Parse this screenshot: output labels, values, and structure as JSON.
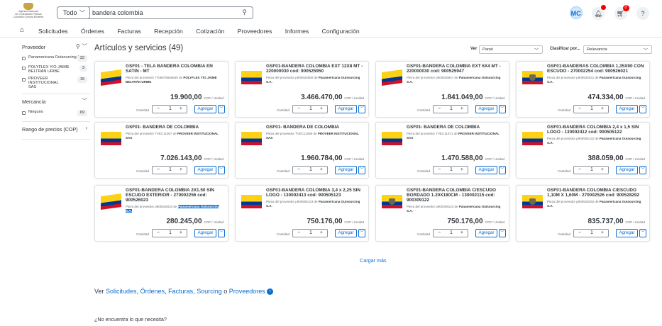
{
  "logo": {
    "lines": [
      "Agencia Nacional",
      "de Contratación Pública",
      "Colombia Compra Eficiente"
    ]
  },
  "search": {
    "scope": "Todo",
    "query": "bandera colombia"
  },
  "user": {
    "initials": "MC",
    "cart_count": "0"
  },
  "help_label": "?",
  "nav": {
    "items": [
      "Solicitudes",
      "Órdenes",
      "Facturas",
      "Recepción",
      "Cotización",
      "Proveedores",
      "Informes",
      "Configuración"
    ]
  },
  "sidebar": {
    "proveedor_title": "Proveedor",
    "suppliers": [
      {
        "name": "Panamericana Outsourcing S.A.",
        "count": "32"
      },
      {
        "name": "POLYFLEX Y/O JAIME BELTRÁN URIBE",
        "count": "3"
      },
      {
        "name": "PROVEER INSTITUCIONAL SAS",
        "count": "15"
      }
    ],
    "mercancia_title": "Mercancía",
    "mercancia": [
      {
        "name": "Ninguno",
        "count": "69"
      }
    ],
    "rango_title": "Rango de precios (COP)"
  },
  "main": {
    "title": "Artículos y servicios (49)",
    "ver_label": "Ver",
    "ver_value": "Panel",
    "sort_label": "Clasificar por...",
    "sort_value": "Relevancia"
  },
  "card_labels": {
    "cantidad": "Cantidad",
    "minus": "−",
    "plus": "+",
    "agregar": "Agregar",
    "unit": "COP / Unidad"
  },
  "cards": [
    {
      "title": "GSF01 - TELA BANDERA COLOMBIA EN SATIN - MT",
      "sup_prefix": "Pieza del proveedor 7705075659849 de",
      "supplier": "POLYFLEX Y/O JAIME BELTRÁN URIBE",
      "price": "19.900,00",
      "qty": "1"
    },
    {
      "title": "GSF01-BANDERA COLOMBIA EXT 12X8 MT - 220000030 cod: 900525950",
      "sup_prefix": "Pieza del proveedor p900525950 de",
      "supplier": "Panamericana Outsourcing S.A.",
      "price": "3.466.470,00",
      "qty": "1"
    },
    {
      "title": "GSF01-BANDERA COLOMBIA EXT 6X4 MT - 220000030 cod: 900525947",
      "sup_prefix": "Pieza del proveedor p900525947 de",
      "supplier": "Panamericana Outsourcing S.A.",
      "price": "1.841.049,00",
      "qty": "1"
    },
    {
      "title": "GSF01-BANDERAS COLOMBIA 1,35X90 CON ESCUDO - 270002254 cod: 900526021",
      "sup_prefix": "Pieza del proveedor p900526021 de",
      "supplier": "Panamericana Outsourcing S.A.",
      "price": "474.334,00",
      "qty": "1"
    },
    {
      "title": "GSF01- BANDERA DE COLOMBIA",
      "sup_prefix": "Pieza del proveedor TVEC11067 de",
      "supplier": "PROVEER INSTITUCIONAL SAS",
      "price": "7.026.143,00",
      "qty": "1"
    },
    {
      "title": "GSF01- BANDERA DE COLOMBIA",
      "sup_prefix": "Pieza del proveedor TVEC11069 de",
      "supplier": "PROVEER INSTITUCIONAL SAS",
      "price": "1.960.784,00",
      "qty": "1"
    },
    {
      "title": "GSF01- BANDERA DE COLOMBIA",
      "sup_prefix": "Pieza del proveedor TVEC11071 de",
      "supplier": "PROVEER INSTITUCIONAL SAS",
      "price": "1.470.588,00",
      "qty": "1"
    },
    {
      "title": "GSF01-BANDERA COLOMBIA 2,4 x 1,5 SIN LOGO - 130002412 cod: 900505122",
      "sup_prefix": "Pieza del proveedor p900505122 de",
      "supplier": "Panamericana Outsourcing S.A.",
      "price": "388.059,00",
      "qty": "1"
    },
    {
      "title": "GSF01-BANDERA COLOMBIA 2X1.50 SIN ESCUDO EXTERIOR - 270002256 cod: 900526023",
      "sup_prefix": "Pieza del proveedor p900526023 de",
      "supplier": "Panamericana Outsourcing S.A.",
      "price": "280.245,00",
      "qty": "1"
    },
    {
      "title": "GSF01-BANDERA COLOMBIA 3,4 x 2,25 SIN LOGO - 130002413 cod: 900505123",
      "sup_prefix": "Pieza del proveedor p900505123 de",
      "supplier": "Panamericana Outsourcing S.A.",
      "price": "750.176,00",
      "qty": "1"
    },
    {
      "title": "GSF01-BANDERA COLOMBIA C/ESCUDO BORDADO 1.20X180CM - 130002115 cod: 900309122",
      "sup_prefix": "Pieza del proveedor p900309122 de",
      "supplier": "Panamericana Outsourcing S.A.",
      "price": "750.176,00",
      "qty": "1"
    },
    {
      "title": "GSF01-BANDERA COLOMBIA C/ESCUDO 1,10M X 1,60M - 270002526 cod: 900528292",
      "sup_prefix": "Pieza del proveedor p900528292 de",
      "supplier": "Panamericana Outsourcing S.A.",
      "price": "835.737,00",
      "qty": "1"
    }
  ],
  "load_more": "Cargar más",
  "browse": {
    "prefix": "Ver",
    "links": [
      "Solicitudes",
      "Órdenes",
      "Facturas",
      "Sourcing",
      "Proveedores"
    ],
    "sep": ",",
    "or": "o"
  },
  "not_found": "¿No encuentra lo que necesita?",
  "colors": {
    "accent": "#0a6ed1",
    "highlight": "#1976d2",
    "text": "#32363a"
  }
}
